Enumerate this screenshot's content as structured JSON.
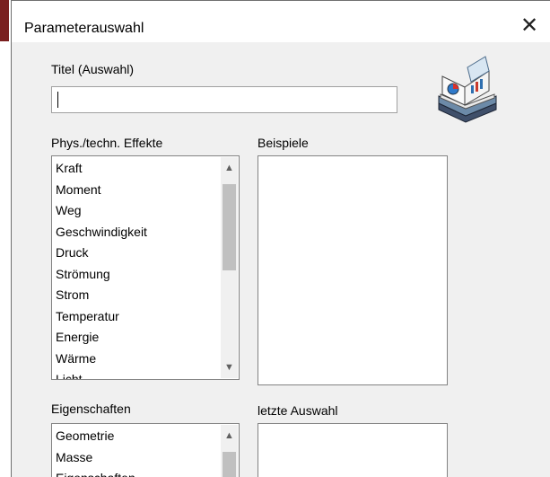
{
  "dialog": {
    "title": "Parameterauswahl",
    "close_symbol": "✕"
  },
  "titel": {
    "label": "Titel  (Auswahl)",
    "value": ""
  },
  "effekte": {
    "label": "Phys./techn. Effekte",
    "items": [
      "Kraft",
      "Moment",
      "Weg",
      "Geschwindigkeit",
      "Druck",
      "Strömung",
      "Strom",
      "Temperatur",
      "Energie",
      "Wärme",
      "Licht"
    ]
  },
  "beispiele": {
    "label": "Beispiele",
    "items": []
  },
  "eigenschaften": {
    "label": "Eigenschaften",
    "items": [
      "Geometrie",
      "Masse",
      "Eigenschaften"
    ]
  },
  "letzte": {
    "label": "letzte Auswahl",
    "items": []
  },
  "icons": {
    "close": "close-icon",
    "book": "book-icon",
    "scroll_up": "chevron-up-icon",
    "scroll_down": "chevron-down-icon"
  },
  "colors": {
    "window_bg": "#f0f0f0",
    "titlebar_bg": "#ffffff",
    "accent_edge": "#7a1f1f"
  }
}
